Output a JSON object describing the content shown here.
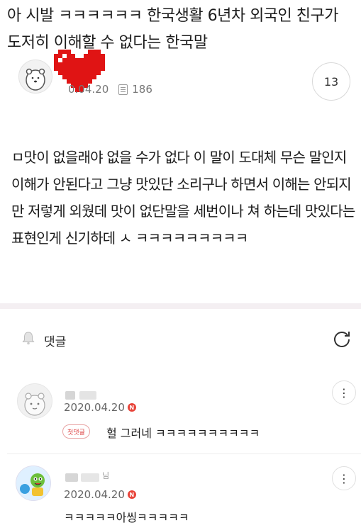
{
  "post": {
    "title": "아 시발 ㅋㅋㅋㅋㅋㅋ 한국생활 6년차 외국인 친구가 도저히 이해할 수 없다는 한국말",
    "date": "2020.04.20",
    "date_visible": "0.04.20",
    "views": "186",
    "comment_count": "13",
    "body": "ㅁ맛이 없을래야 없을 수가 없다 이 말이 도대체 무슨 말인지 이해가 안된다고 그냥 맛있단 소리구나 하면서 이해는 안되지만 저렇게 외웠데 맛이 없단말을 세번이나 쳐 하는데 맛있다는 표현인게 신기하데 ㅅ ㅋㅋㅋㅋㅋㅋㅋㅋㅋ"
  },
  "comments_section": {
    "label": "댓글"
  },
  "comments": [
    {
      "name_partial": "",
      "date": "2020.04.20",
      "badge": "N",
      "tag": "첫댓글",
      "text": "헐 그러네 ㅋㅋㅋㅋㅋㅋㅋㅋㅋㅋ"
    },
    {
      "name_partial": "님",
      "date": "2020.04.20",
      "badge": "N",
      "text": "ㅋㅋㅋㅋㅋ아씽ㅋㅋㅋㅋㅋ"
    }
  ],
  "icons": {
    "author": "polar-bear-avatar-icon",
    "censor": "pixel-heart-icon",
    "views": "document-icon",
    "bell": "bell-icon",
    "refresh": "refresh-icon",
    "more": "more-vertical-icon"
  },
  "colors": {
    "accent": "#e8443a",
    "divider": "#f4eff2",
    "heart": "#e01414"
  }
}
